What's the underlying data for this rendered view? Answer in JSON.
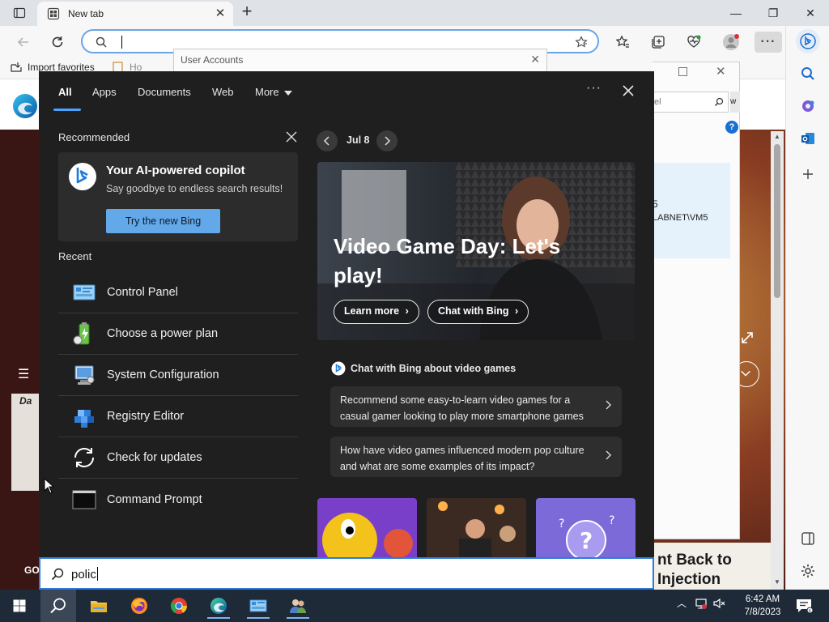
{
  "browser": {
    "tab_title": "New tab",
    "address_value": "",
    "bookmark_label": "Import favorites",
    "bookmark_partial": "Ho",
    "window_controls": [
      "minimize",
      "restore",
      "close"
    ]
  },
  "background_window": {
    "title": "User Accounts",
    "search_label": "el",
    "help": "?",
    "card_number": "5",
    "card_user": "LABNET\\VM5",
    "tab_partial": "w"
  },
  "page": {
    "go_label": "GO",
    "headline": "nt Back to Injection"
  },
  "search_flyout": {
    "tabs": [
      "All",
      "Apps",
      "Documents",
      "Web",
      "More"
    ],
    "active_tab": "All",
    "more_options": "···",
    "recommended_label": "Recommended",
    "copilot": {
      "title": "Your AI-powered copilot",
      "subtitle": "Say goodbye to endless search results!",
      "button": "Try the new Bing"
    },
    "recent_label": "Recent",
    "recent": [
      {
        "label": "Control Panel",
        "icon": "control-panel-icon"
      },
      {
        "label": "Choose a power plan",
        "icon": "power-plan-icon"
      },
      {
        "label": "System Configuration",
        "icon": "system-configuration-icon"
      },
      {
        "label": "Registry Editor",
        "icon": "registry-editor-icon"
      },
      {
        "label": "Check for updates",
        "icon": "check-updates-icon"
      },
      {
        "label": "Command Prompt",
        "icon": "command-prompt-icon"
      }
    ],
    "date": "Jul 8",
    "hero": {
      "title": "Video Game Day: Let's play!",
      "learn_more": "Learn more",
      "chat_with_bing": "Chat with Bing"
    },
    "chat_header": "Chat with Bing about video games",
    "suggestions": [
      "Recommend some easy-to-learn video games for a casual gamer looking to play more smartphone games",
      "How have video games influenced modern pop culture and what are some examples of its impact?"
    ],
    "search_query": "polic"
  },
  "taskbar": {
    "time": "6:42 AM",
    "date": "7/8/2023"
  },
  "colors": {
    "accent": "#4aa3ff",
    "copilot_button": "#63a8e8",
    "flyout_bg": "#1f1f1f",
    "taskbar_bg": "#1f2a38"
  }
}
